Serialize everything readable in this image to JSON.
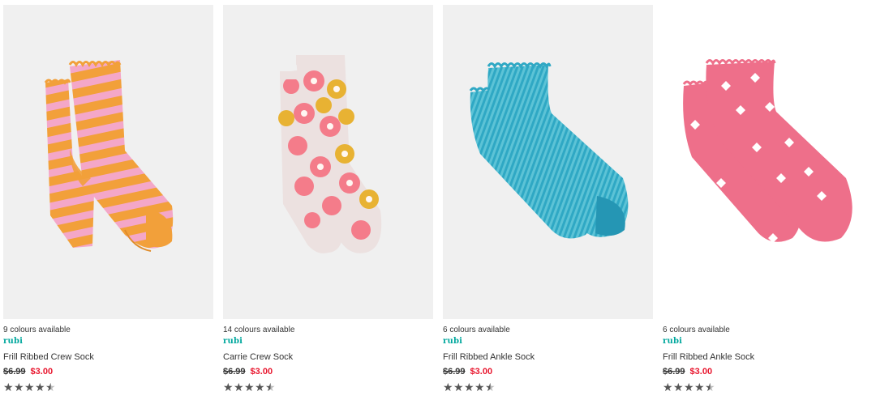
{
  "colors": {
    "brand": "#00a79d",
    "sale": "#e8152d",
    "text": "#333333",
    "star": "#555555"
  },
  "products": [
    {
      "colours_text": "9 colours available",
      "brand": "rubi",
      "name": "Frill Ribbed Crew Sock",
      "was_price": "$6.99",
      "now_price": "$3.00",
      "rating": 4.5,
      "rating_max": 5,
      "image_icon": "orange-pink-striped-socks-image"
    },
    {
      "colours_text": "14 colours available",
      "brand": "rubi",
      "name": "Carrie Crew Sock",
      "was_price": "$6.99",
      "now_price": "$3.00",
      "rating": 4.5,
      "rating_max": 5,
      "image_icon": "floral-crew-socks-image"
    },
    {
      "colours_text": "6 colours available",
      "brand": "rubi",
      "name": "Frill Ribbed Ankle Sock",
      "was_price": "$6.99",
      "now_price": "$3.00",
      "rating": 4.5,
      "rating_max": 5,
      "image_icon": "blue-marled-ankle-socks-image"
    },
    {
      "colours_text": "6 colours available",
      "brand": "rubi",
      "name": "Frill Ribbed Ankle Sock",
      "was_price": "$6.99",
      "now_price": "$3.00",
      "rating": 4.5,
      "rating_max": 5,
      "image_icon": "pink-butterfly-ankle-socks-image"
    }
  ]
}
